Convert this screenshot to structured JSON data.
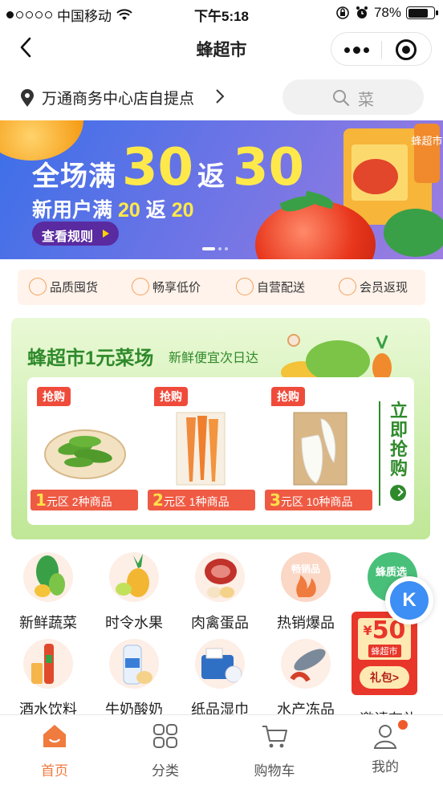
{
  "status_bar": {
    "carrier": "中国移动",
    "time": "下午5:18",
    "battery": "78%",
    "battery_level": 0.78
  },
  "nav": {
    "title": "蜂超市"
  },
  "location": {
    "store": "万通商务中心店自提点"
  },
  "search": {
    "placeholder": "菜"
  },
  "banner": {
    "line1_prefix": "全场满",
    "line1_num1": "30",
    "line1_mid": "返",
    "line1_num2": "30",
    "line2_prefix": "新用户满",
    "line2_num1": "20",
    "line2_mid": "返",
    "line2_num2": "20",
    "button": "查看规则",
    "side_tag": "蜂超市",
    "slides": 3,
    "active_slide": 1
  },
  "features": [
    "品质囤货",
    "畅享低价",
    "自营配送",
    "会员返现"
  ],
  "market": {
    "title": "蜂超市1元菜场",
    "subtitle": "新鲜便宜次日达",
    "products": [
      {
        "tag": "抢购",
        "price_num": "1",
        "price_text": "元区 2种商品"
      },
      {
        "tag": "抢购",
        "price_num": "2",
        "price_text": "元区 1种商品"
      },
      {
        "tag": "抢购",
        "price_num": "3",
        "price_text": "元区 10种商品"
      }
    ],
    "grab_label": "立即抢购"
  },
  "categories": {
    "row1": [
      "新鲜蔬菜",
      "时令水果",
      "肉禽蛋品",
      "热销爆品"
    ],
    "row2": [
      "酒水饮料",
      "牛奶酸奶",
      "纸品湿巾",
      "水产冻品",
      "邀请有礼"
    ],
    "hot_pill": "畅销品",
    "partial_pill": "蜂质选",
    "gift": {
      "amount": "50",
      "brand": "蜂超市",
      "button": "礼包>",
      "currency": "¥"
    }
  },
  "float_button": {
    "label": "K"
  },
  "tabbar": {
    "tabs": [
      "首页",
      "分类",
      "购物车",
      "我的"
    ],
    "active": 0
  }
}
